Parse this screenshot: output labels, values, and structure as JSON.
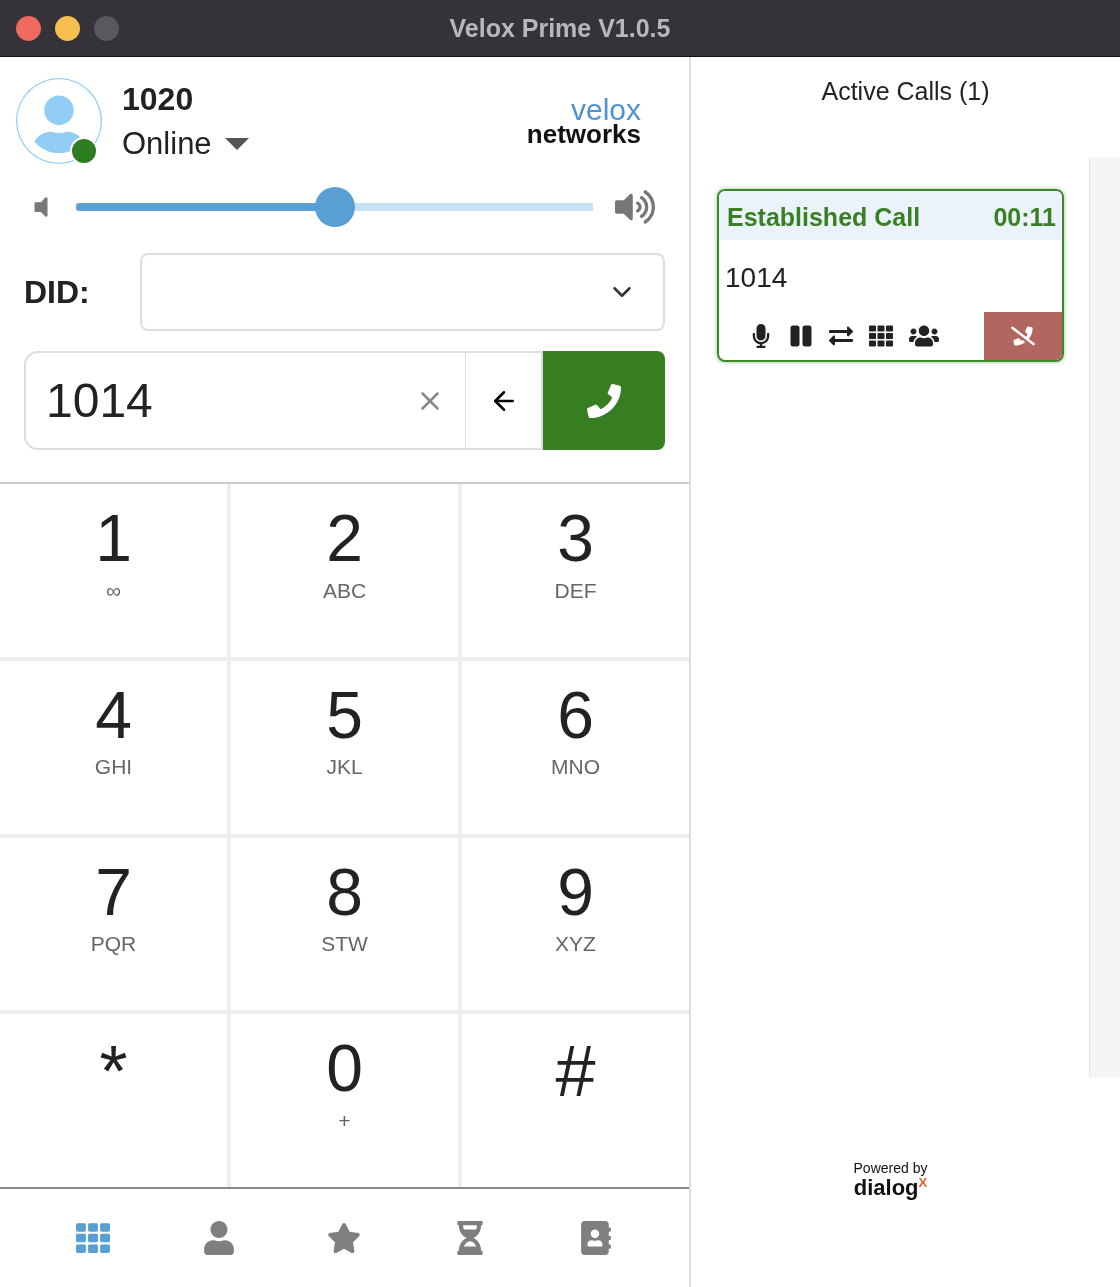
{
  "window": {
    "title": "Velox Prime V1.0.5"
  },
  "user": {
    "extension": "1020",
    "status": "Online",
    "online": true
  },
  "logo": {
    "line_1": "velox",
    "line_2": "networks"
  },
  "volume": {
    "level": 0.5
  },
  "did": {
    "label": "DID:"
  },
  "dial_input": {
    "value": "1014"
  },
  "keypad": [
    {
      "digit": "1",
      "letters": "∞"
    },
    {
      "digit": "2",
      "letters": "ABC"
    },
    {
      "digit": "3",
      "letters": "DEF"
    },
    {
      "digit": "4",
      "letters": "GHI"
    },
    {
      "digit": "5",
      "letters": "JKL"
    },
    {
      "digit": "6",
      "letters": "MNO"
    },
    {
      "digit": "7",
      "letters": "PQR"
    },
    {
      "digit": "8",
      "letters": "STW"
    },
    {
      "digit": "9",
      "letters": "XYZ"
    },
    {
      "digit": "*"
    },
    {
      "digit": "0",
      "letters": "+"
    },
    {
      "digit": "#"
    }
  ],
  "bottom_nav": [
    {
      "kind": "keypad",
      "selected": true
    },
    {
      "kind": "person",
      "selected": false
    },
    {
      "kind": "star",
      "selected": false
    },
    {
      "kind": "history",
      "selected": false
    },
    {
      "kind": "contacts",
      "selected": false
    }
  ],
  "active_calls": {
    "title": "Active Calls (1)",
    "calls": [
      {
        "state": "Established Call",
        "timer": "00:11",
        "number": "1014"
      }
    ]
  },
  "footer": {
    "powered_by": "Powered by",
    "brand": "dialog$^{X}$"
  }
}
